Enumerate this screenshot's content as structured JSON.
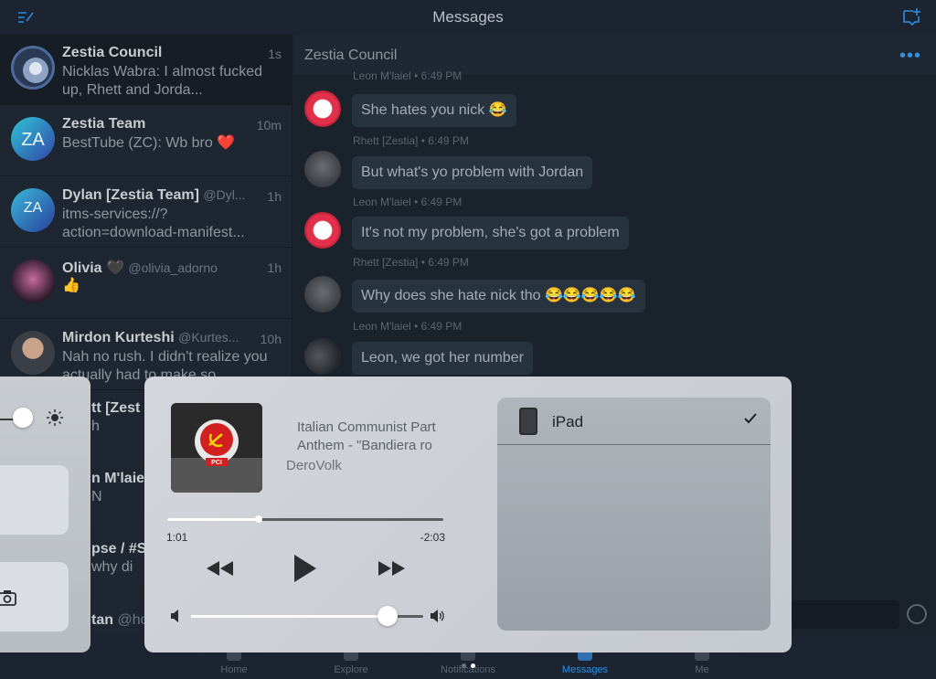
{
  "topbar": {
    "title": "Messages"
  },
  "conversations": [
    {
      "name": "Zestia Council",
      "handle": "",
      "time": "1s",
      "preview": "Nicklas Wabra: I almost fucked up, Rhett and Jorda..."
    },
    {
      "name": "Zestia Team",
      "handle": "",
      "time": "10m",
      "preview": "BestTube (ZC): Wb bro ❤️"
    },
    {
      "name": "Dylan [Zestia Team]",
      "handle": "@Dyl...",
      "time": "1h",
      "preview": "itms-services://?action=download-manifest..."
    },
    {
      "name": "Olivia 🖤",
      "handle": "@olivia_adorno",
      "time": "1h",
      "preview": "👍"
    },
    {
      "name": "Mirdon Kurteshi",
      "handle": "@Kurtes...",
      "time": "10h",
      "preview": "Nah no rush. I didn't realize you actually had to make so..."
    }
  ],
  "partial_rows": [
    {
      "name": "tt [Zest",
      "preview": "h"
    },
    {
      "name": "n M'laie",
      "preview": "N"
    },
    {
      "name": "pse / #S",
      "preview": "why di"
    },
    {
      "name": "tan",
      "preview": "@ho"
    }
  ],
  "chat": {
    "title": "Zestia Council",
    "more_label": "•••",
    "top_meta": "Leon M'laiel • 6:49 PM",
    "messages": [
      {
        "text": "She hates you nick 😂",
        "meta": "Rhett [Zestia] • 6:49 PM",
        "sender": "leon"
      },
      {
        "text": "But what's yo problem with Jordan",
        "meta": "Leon M'laiel • 6:49 PM",
        "sender": "rhett"
      },
      {
        "text": "It's not my problem, she's got a problem",
        "meta": "Rhett [Zestia] • 6:49 PM",
        "sender": "leon"
      },
      {
        "text": "Why does she hate nick tho 😂😂😂😂😂",
        "meta": "Leon M'laiel • 6:49 PM",
        "sender": "rhett"
      },
      {
        "text": "Leon, we got her number",
        "meta": "",
        "sender": "group"
      }
    ]
  },
  "tabs": [
    {
      "label": "Home",
      "active": false
    },
    {
      "label": "Explore",
      "active": false
    },
    {
      "label": "Notifications",
      "active": false
    },
    {
      "label": "Messages",
      "active": true
    },
    {
      "label": "Me",
      "active": false
    }
  ],
  "now_playing": {
    "title_line1": "Italian Communist Part",
    "title_line2": "Anthem - \"Bandiera ro",
    "artist": "DeroVolk",
    "elapsed": "1:01",
    "remaining": "-2:03",
    "progress_fraction": 0.33,
    "volume_fraction": 0.845,
    "artwork_label": "PCI"
  },
  "airplay": {
    "device": "iPad",
    "selected": true
  },
  "page_dots": {
    "count": 2,
    "active_index": 1
  },
  "colors": {
    "accent": "#2d8ee6",
    "cc_panel": "#cdd0d6"
  }
}
